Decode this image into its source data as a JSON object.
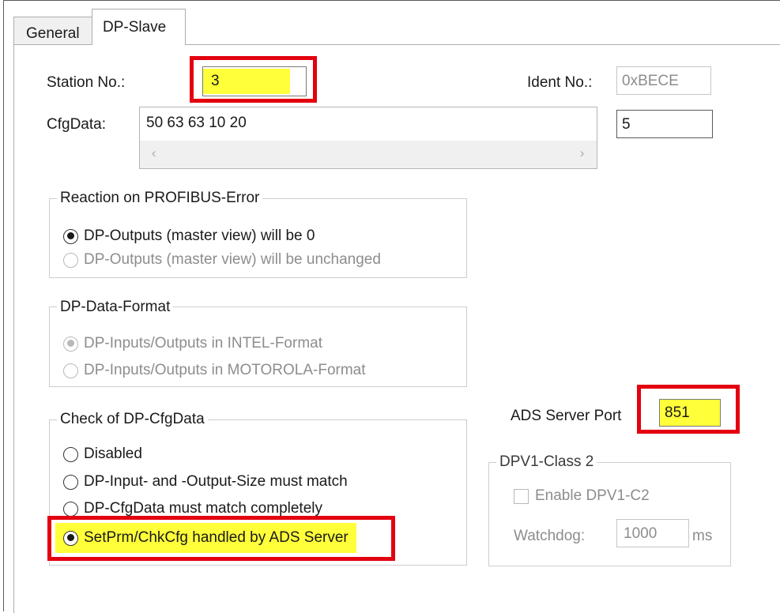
{
  "tabs": [
    {
      "label": "General"
    },
    {
      "label": "DP-Slave"
    }
  ],
  "station_no": {
    "label": "Station No.:",
    "value": "3"
  },
  "ident_no": {
    "label": "Ident No.:",
    "value": "0xBECE"
  },
  "cfgdata": {
    "label": "CfgData:",
    "value": "50 63 63 10 20",
    "length": "5"
  },
  "reaction_group": {
    "title": "Reaction on PROFIBUS-Error",
    "options": [
      {
        "label": "DP-Outputs (master view) will be 0"
      },
      {
        "label": "DP-Outputs (master view) will be unchanged"
      }
    ]
  },
  "data_format_group": {
    "title": "DP-Data-Format",
    "options": [
      {
        "label": "DP-Inputs/Outputs in INTEL-Format"
      },
      {
        "label": "DP-Inputs/Outputs in MOTOROLA-Format"
      }
    ]
  },
  "check_cfg_group": {
    "title": "Check of DP-CfgData",
    "options": [
      {
        "label": "Disabled"
      },
      {
        "label": "DP-Input- and -Output-Size must match"
      },
      {
        "label": "DP-CfgData must match completely"
      },
      {
        "label": "SetPrm/ChkCfg handled by ADS Server"
      }
    ]
  },
  "ads_server_port": {
    "label": "ADS Server Port",
    "value": "851"
  },
  "dpv1_group": {
    "title": "DPV1-Class 2",
    "enable_label": "Enable DPV1-C2",
    "watchdog_label": "Watchdog:",
    "watchdog_value": "1000",
    "watchdog_unit": "ms"
  },
  "colors": {
    "highlight": "#ffff3a",
    "annotation_red": "#e3000f"
  }
}
